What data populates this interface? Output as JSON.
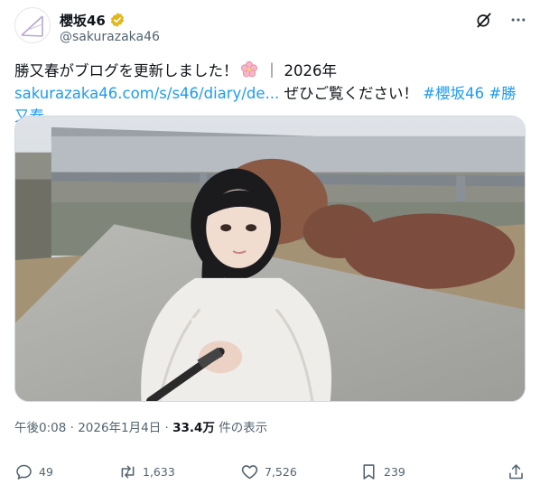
{
  "account": {
    "display_name": "櫻坂46",
    "handle": "@sakurazaka46"
  },
  "tweet": {
    "text_prefix": "勝又春がブログを更新しました！",
    "text_divider": "｜ 2026年",
    "link_text": "sakurazaka46.com/s/s46/diary/de...",
    "text_mid": "ぜひご覧ください！",
    "hashtags": [
      "#櫻坂46",
      "#勝又春"
    ]
  },
  "meta": {
    "timestamp": "午後0:08 · 2026年1月4日 · ",
    "views": "33.4万",
    "views_label": " 件の表示"
  },
  "actions": {
    "replies": "49",
    "reposts": "1,633",
    "likes": "7,526",
    "bookmarks": "239"
  },
  "colors": {
    "link": "#1d9bf0",
    "secondary_text": "#536471",
    "verified_gold": "#e2b719"
  }
}
